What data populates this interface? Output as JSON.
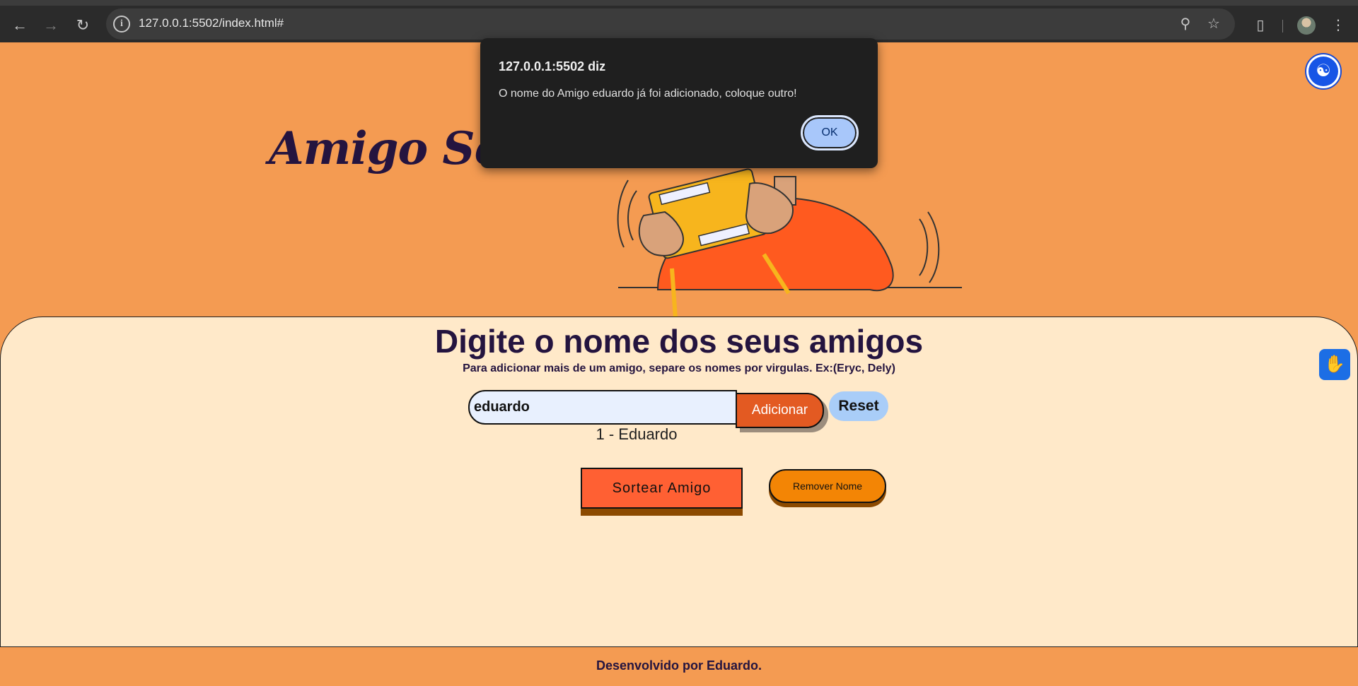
{
  "browser": {
    "url": "127.0.0.1:5502/index.html#",
    "icons": [
      "back-arrow-icon",
      "forward-arrow-icon",
      "reload-icon",
      "site-info-icon",
      "zoom-icon",
      "bookmark-star-icon",
      "extensions-icon",
      "profile-avatar",
      "menu-dots-icon"
    ]
  },
  "dialog": {
    "title": "127.0.0.1:5502 diz",
    "message": "O nome do Amigo eduardo já foi adicionado, coloque outro!",
    "ok_label": "OK"
  },
  "header": {
    "title": "Amigo Secreto"
  },
  "main": {
    "heading": "Digite o nome dos seus amigos",
    "subheading": "Para adicionar mais de um amigo, separe os nomes por virgulas. Ex:(Eryc, Dely)",
    "input_value": "eduardo",
    "add_label": "Adicionar",
    "reset_label": "Reset",
    "friends": [
      "1 - Eduardo"
    ],
    "draw_label": "Sortear Amigo",
    "remove_label": "Remover Nome"
  },
  "footer": {
    "text": "Desenvolvido por Eduardo."
  },
  "colors": {
    "background": "#f49b52",
    "panel": "#ffe9c9",
    "title": "#24143f",
    "add_button": "#e35a22",
    "draw_button": "#ff6033",
    "remove_button": "#f38505",
    "reset_button": "#a9cdf8"
  }
}
